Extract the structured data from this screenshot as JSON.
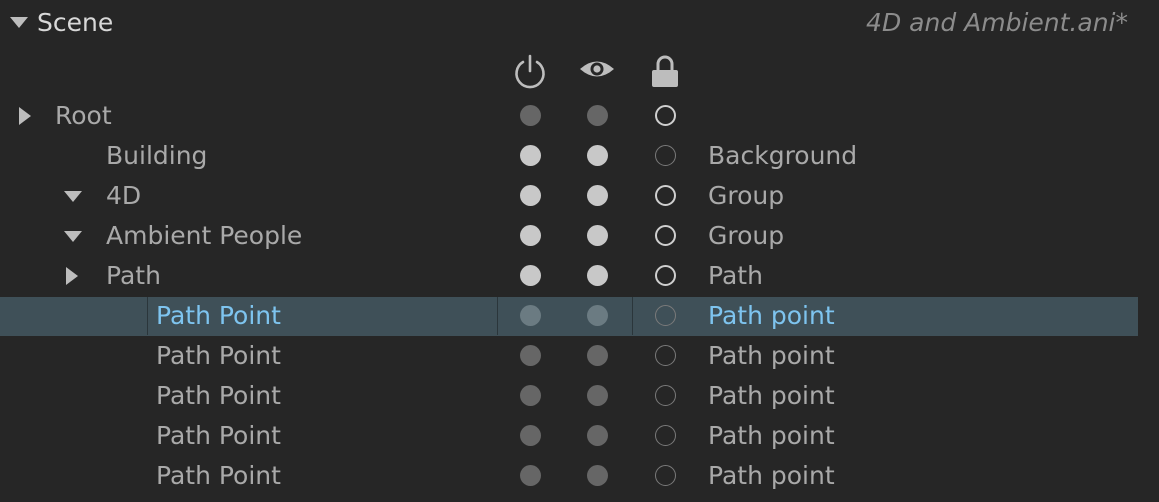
{
  "header": {
    "title": "Scene",
    "file_name": "4D and Ambient.ani*"
  },
  "columns": {
    "power_icon": "power-icon",
    "visibility_icon": "eye-icon",
    "lock_icon": "lock-icon"
  },
  "colors": {
    "background": "#262626",
    "selection": "#3f5058",
    "selected_text": "#7ec4ef",
    "text": "#a9a9a9"
  },
  "rows": [
    {
      "label": "Root",
      "type": "",
      "expander": "collapsed",
      "indent": 0,
      "power": "dim",
      "visible": "dim",
      "locked": false,
      "lock_ring": "bright",
      "selected": false
    },
    {
      "label": "Building",
      "type": "Background",
      "expander": "none",
      "indent": 1,
      "power": "bright",
      "visible": "bright",
      "locked": false,
      "lock_ring": "dim",
      "selected": false
    },
    {
      "label": "4D",
      "type": "Group",
      "expander": "expanded",
      "indent": 1,
      "power": "bright",
      "visible": "bright",
      "locked": false,
      "lock_ring": "bright",
      "selected": false
    },
    {
      "label": "Ambient People",
      "type": "Group",
      "expander": "expanded",
      "indent": 1,
      "power": "bright",
      "visible": "bright",
      "locked": false,
      "lock_ring": "bright",
      "selected": false
    },
    {
      "label": "Path",
      "type": "Path",
      "expander": "collapsed",
      "indent": 1,
      "power": "bright",
      "visible": "bright",
      "locked": false,
      "lock_ring": "bright",
      "selected": false
    },
    {
      "label": "Path Point",
      "type": "Path point",
      "expander": "none",
      "indent": 2,
      "power": "sel",
      "visible": "sel",
      "locked": false,
      "lock_ring": "dim",
      "selected": true
    },
    {
      "label": "Path Point",
      "type": "Path point",
      "expander": "none",
      "indent": 2,
      "power": "dim",
      "visible": "dim",
      "locked": false,
      "lock_ring": "dim",
      "selected": false
    },
    {
      "label": "Path Point",
      "type": "Path point",
      "expander": "none",
      "indent": 2,
      "power": "dim",
      "visible": "dim",
      "locked": false,
      "lock_ring": "dim",
      "selected": false
    },
    {
      "label": "Path Point",
      "type": "Path point",
      "expander": "none",
      "indent": 2,
      "power": "dim",
      "visible": "dim",
      "locked": false,
      "lock_ring": "dim",
      "selected": false
    },
    {
      "label": "Path Point",
      "type": "Path point",
      "expander": "none",
      "indent": 2,
      "power": "dim",
      "visible": "dim",
      "locked": false,
      "lock_ring": "dim",
      "selected": false
    }
  ]
}
